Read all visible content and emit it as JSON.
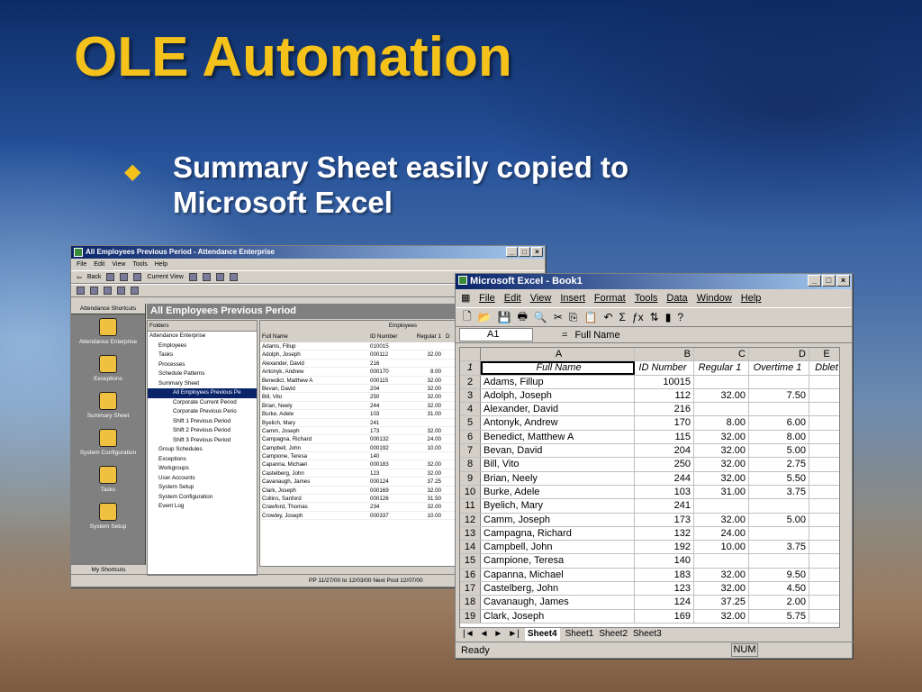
{
  "slide": {
    "title": "OLE Automation",
    "bullet_glyph": "◆",
    "bullet": "Summary Sheet easily copied to Microsoft Excel"
  },
  "ae_app": {
    "title": "All Employees Previous Period - Attendance Enterprise",
    "menu": [
      "File",
      "Edit",
      "View",
      "Tools",
      "Help"
    ],
    "toolbar_back": "Back",
    "toolbar_current_view": "Current View",
    "shortcuts_header": "Attendance Shortcuts",
    "shortcuts": [
      "Attendance Enterprise",
      "Exceptions",
      "Summary Sheet",
      "System Configuration",
      "Tasks",
      "System Setup"
    ],
    "shortcuts_footer": "My Shortcuts",
    "pane_title": "All Employees Previous Period",
    "folders_header": "Folders",
    "tree": [
      "Attendance Enterprise",
      "Employees",
      "Tasks",
      "Processes",
      "Schedule Patterns",
      "Summary Sheet",
      "All Employees Previous Pe",
      "Corporate Current Period",
      "Corporate Previous Perio",
      "Shift 1 Previous Period",
      "Shift 2 Previous Period",
      "Shift 3 Previous Period",
      "Group Schedules",
      "Exceptions",
      "Workgroups",
      "User Accounts",
      "System Setup",
      "System Configuration",
      "Event Log"
    ],
    "grid_group_header": "Employees",
    "grid_headers": [
      "Full Name",
      "ID Number",
      "Regular 1",
      "D"
    ],
    "grid_rows": [
      [
        "Adams, Fillup",
        "010015",
        ""
      ],
      [
        "Adolph, Joseph",
        "000112",
        "32.00"
      ],
      [
        "Alexander, David",
        "216",
        ""
      ],
      [
        "Antonyk, Andrew",
        "000170",
        "8.00"
      ],
      [
        "Benedict, Matthew A",
        "000115",
        "32.00"
      ],
      [
        "Bevan, David",
        "204",
        "32.00"
      ],
      [
        "Bill, Vito",
        "250",
        "32.00"
      ],
      [
        "Brian, Neely",
        "244",
        "32.00"
      ],
      [
        "Burke, Adele",
        "103",
        "31.00"
      ],
      [
        "Byelich, Mary",
        "241",
        ""
      ],
      [
        "Camm, Joseph",
        "173",
        "32.00"
      ],
      [
        "Campagna, Richard",
        "000132",
        "24.00"
      ],
      [
        "Campbell, John",
        "000192",
        "10.00"
      ],
      [
        "Campione, Teresa",
        "140",
        ""
      ],
      [
        "Capanna, Michael",
        "000183",
        "32.00"
      ],
      [
        "Castelberg, John",
        "123",
        "32.00"
      ],
      [
        "Cavanaugh, James",
        "000124",
        "37.25"
      ],
      [
        "Clark, Joseph",
        "000169",
        "32.00"
      ],
      [
        "Collins, Sanford",
        "000126",
        "31.50"
      ],
      [
        "Crawford, Thomas",
        "234",
        "32.00"
      ],
      [
        "Crowley, Joseph",
        "000337",
        "10.00"
      ]
    ],
    "status": "PP 11/27/00 to 12/03/00 Next Post 12/07/00"
  },
  "excel": {
    "title": "Microsoft Excel - Book1",
    "menu": [
      "File",
      "Edit",
      "View",
      "Insert",
      "Format",
      "Tools",
      "Data",
      "Window",
      "Help"
    ],
    "name_box": "A1",
    "formula_eq": "=",
    "formula_value": "Full Name",
    "col_headers": [
      "A",
      "B",
      "C",
      "D",
      "E"
    ],
    "header_row": [
      "Full Name",
      "ID Number",
      "Regular 1",
      "Overtime 1",
      "Dblet"
    ],
    "rows": [
      [
        "2",
        "Adams, Fillup",
        "10015",
        "",
        ""
      ],
      [
        "3",
        "Adolph, Joseph",
        "112",
        "32.00",
        "7.50"
      ],
      [
        "4",
        "Alexander, David",
        "216",
        "",
        ""
      ],
      [
        "5",
        "Antonyk, Andrew",
        "170",
        "8.00",
        "6.00"
      ],
      [
        "6",
        "Benedict, Matthew A",
        "115",
        "32.00",
        "8.00"
      ],
      [
        "7",
        "Bevan, David",
        "204",
        "32.00",
        "5.00"
      ],
      [
        "8",
        "Bill, Vito",
        "250",
        "32.00",
        "2.75"
      ],
      [
        "9",
        "Brian, Neely",
        "244",
        "32.00",
        "5.50"
      ],
      [
        "10",
        "Burke, Adele",
        "103",
        "31.00",
        "3.75"
      ],
      [
        "11",
        "Byelich, Mary",
        "241",
        "",
        ""
      ],
      [
        "12",
        "Camm, Joseph",
        "173",
        "32.00",
        "5.00"
      ],
      [
        "13",
        "Campagna, Richard",
        "132",
        "24.00",
        ""
      ],
      [
        "14",
        "Campbell, John",
        "192",
        "10.00",
        "3.75"
      ],
      [
        "15",
        "Campione, Teresa",
        "140",
        "",
        ""
      ],
      [
        "16",
        "Capanna, Michael",
        "183",
        "32.00",
        "9.50"
      ],
      [
        "17",
        "Castelberg, John",
        "123",
        "32.00",
        "4.50"
      ],
      [
        "18",
        "Cavanaugh, James",
        "124",
        "37.25",
        "2.00"
      ],
      [
        "19",
        "Clark, Joseph",
        "169",
        "32.00",
        "5.75"
      ]
    ],
    "sheet_tabs": [
      "Sheet4",
      "Sheet1",
      "Sheet2",
      "Sheet3"
    ],
    "status_ready": "Ready",
    "status_num": "NUM"
  }
}
